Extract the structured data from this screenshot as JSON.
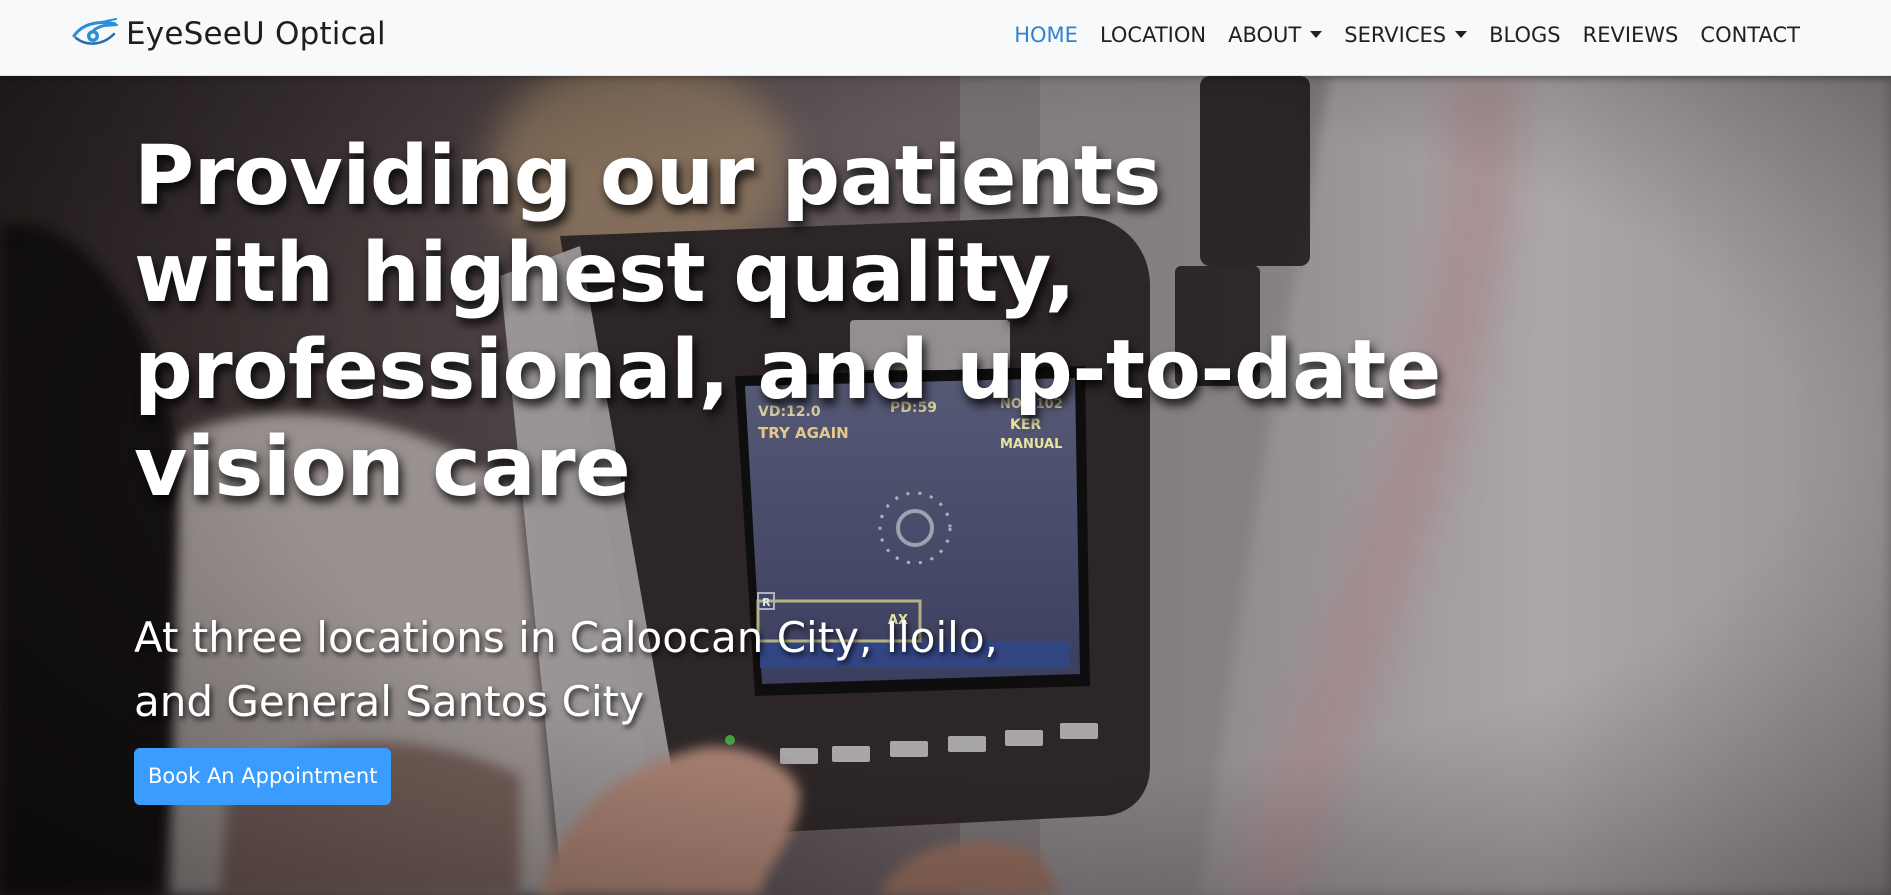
{
  "brand": {
    "name": "EyeSeeU Optical",
    "logo_icon": "eye-logo-icon"
  },
  "nav": {
    "items": [
      {
        "label": "HOME",
        "active": true,
        "dropdown": false
      },
      {
        "label": "LOCATION",
        "active": false,
        "dropdown": false
      },
      {
        "label": "ABOUT",
        "active": false,
        "dropdown": true
      },
      {
        "label": "SERVICES",
        "active": false,
        "dropdown": true
      },
      {
        "label": "BLOGS",
        "active": false,
        "dropdown": false
      },
      {
        "label": "REVIEWS",
        "active": false,
        "dropdown": false
      },
      {
        "label": "CONTACT",
        "active": false,
        "dropdown": false
      }
    ]
  },
  "hero": {
    "headline_lines": [
      "Providing our patients",
      "with highest quality,",
      "professional, and up-to-date",
      "vision care"
    ],
    "subline_lines": [
      "At three locations in Caloocan City, Iloilo,",
      "and General Santos City"
    ],
    "cta_label": "Book An Appointment",
    "device_screen": {
      "readings": [
        "VD:12.0",
        "PD:59",
        "NO.2102"
      ],
      "status": "TRY AGAIN",
      "mode_labels": [
        "KER",
        "MANUAL"
      ],
      "side_marker": "R",
      "lower_label": "AX"
    }
  },
  "colors": {
    "navbar_bg": "#f8f9fa",
    "active_link": "#2f83d0",
    "cta_bg": "#3b9cff",
    "text_dark": "#212121",
    "text_light": "#ffffff"
  }
}
